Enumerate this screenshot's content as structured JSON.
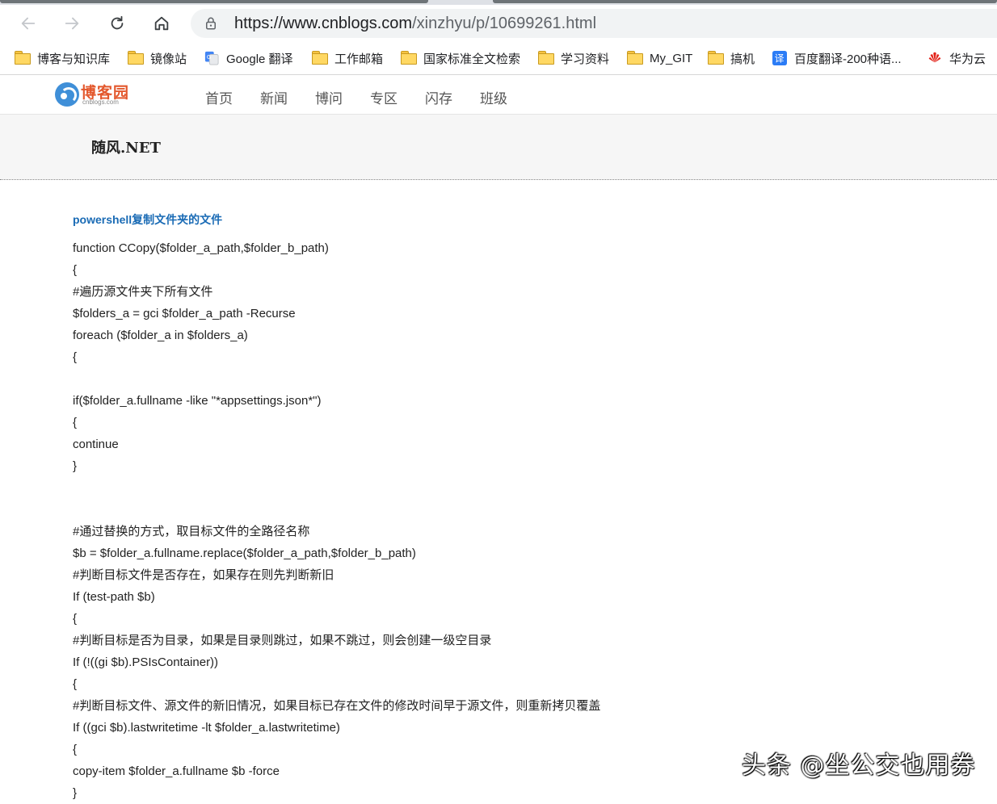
{
  "browser": {
    "url_host": "https://www.cnblogs.com",
    "url_path": "/xinzhyu/p/10699261.html",
    "icons": [
      "back-icon",
      "forward-icon",
      "reload-icon",
      "home-icon",
      "lock-icon"
    ]
  },
  "bookmarks": [
    {
      "label": "博客与知识库",
      "icon": "folder-icon"
    },
    {
      "label": "镜像站",
      "icon": "folder-icon"
    },
    {
      "label": "Google 翻译",
      "icon": "google-translate-icon"
    },
    {
      "label": "工作邮箱",
      "icon": "folder-icon"
    },
    {
      "label": "国家标准全文检索",
      "icon": "folder-icon"
    },
    {
      "label": "学习资料",
      "icon": "folder-icon"
    },
    {
      "label": "My_GIT",
      "icon": "folder-icon"
    },
    {
      "label": "搞机",
      "icon": "folder-icon"
    },
    {
      "label": "百度翻译-200种语...",
      "icon": "baidu-translate-icon"
    },
    {
      "label": "华为云",
      "icon": "huawei-icon"
    }
  ],
  "site": {
    "logo_name": "博客园",
    "logo_sub": "cnblogs.com",
    "menu": [
      "首页",
      "新闻",
      "博问",
      "专区",
      "闪存",
      "班级"
    ],
    "blog_title": "随风.NET"
  },
  "post": {
    "title": "powershell复制文件夹的文件",
    "lines": [
      "function CCopy($folder_a_path,$folder_b_path)",
      "{",
      "#遍历源文件夹下所有文件",
      "$folders_a = gci $folder_a_path -Recurse",
      "foreach ($folder_a in $folders_a)",
      "{",
      "",
      "if($folder_a.fullname -like \"*appsettings.json*\")",
      "{",
      "continue",
      "}",
      "",
      "",
      "#通过替换的方式，取目标文件的全路径名称",
      "$b = $folder_a.fullname.replace($folder_a_path,$folder_b_path)",
      "#判断目标文件是否存在，如果存在则先判断新旧",
      "If (test-path $b)",
      "{",
      "#判断目标是否为目录，如果是目录则跳过，如果不跳过，则会创建一级空目录",
      "If (!((gi $b).PSIsContainer))",
      "{",
      "#判断目标文件、源文件的新旧情况，如果目标已存在文件的修改时间早于源文件，则重新拷贝覆盖",
      "If ((gci $b).lastwritetime -lt $folder_a.lastwritetime)",
      "{",
      "copy-item $folder_a.fullname $b -force",
      "}"
    ]
  },
  "watermark": "头条 @坐公交也用券"
}
